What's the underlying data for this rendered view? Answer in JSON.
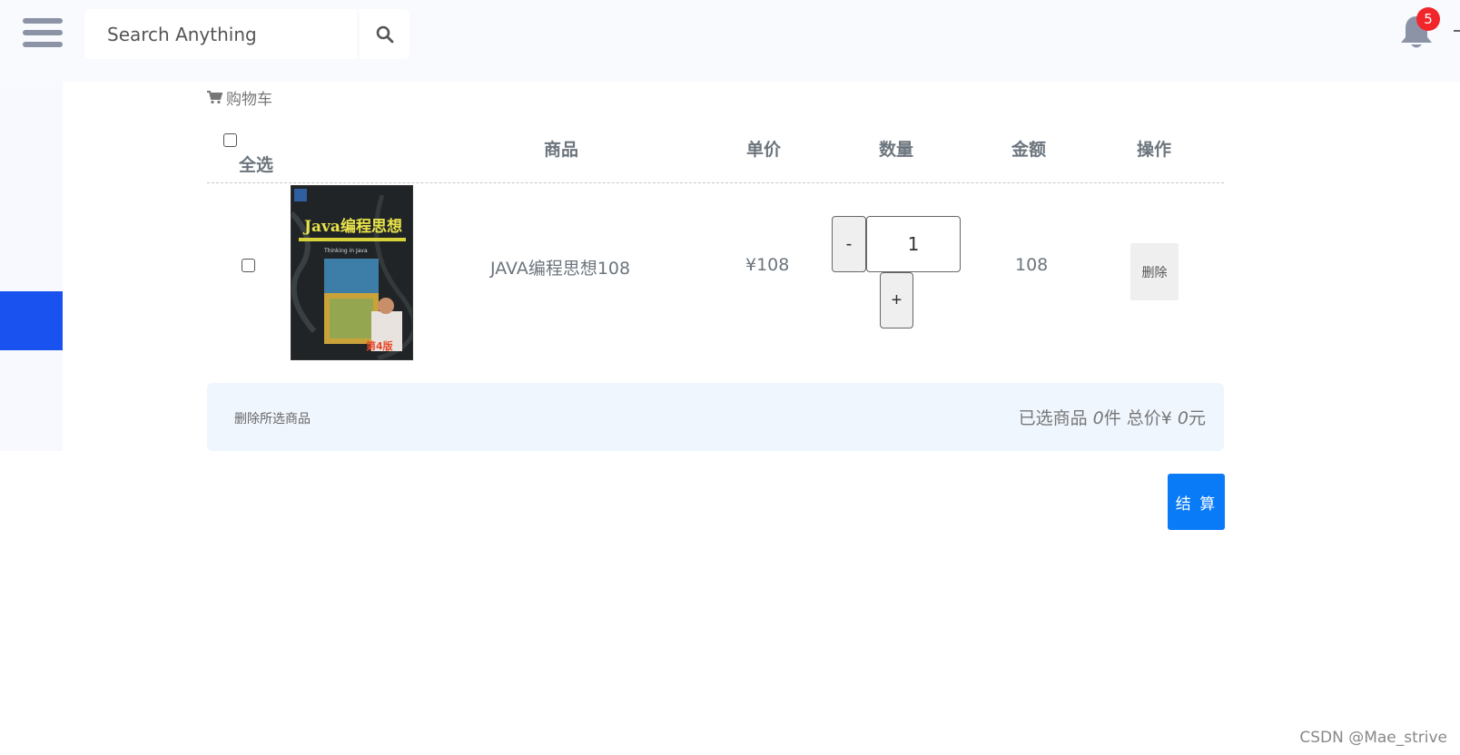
{
  "header": {
    "search_placeholder": "Search Anything",
    "notification_count": "5"
  },
  "breadcrumb": {
    "label": "购物车"
  },
  "table": {
    "headers": {
      "select_all": "全选",
      "product": "商品",
      "unit_price": "单价",
      "quantity": "数量",
      "amount": "金额",
      "action": "操作"
    },
    "rows": [
      {
        "book_cover_title": "Java编程思想",
        "book_cover_subtitle": "Thinking in Java",
        "book_cover_edition": "第4版",
        "product_name": "JAVA编程思想108",
        "unit_price": "¥108",
        "quantity": "1",
        "amount": "108",
        "delete_label": "删除",
        "minus_label": "-",
        "plus_label": "+"
      }
    ]
  },
  "summary": {
    "delete_selected": "删除所选商品",
    "selected_prefix": "已选商品 ",
    "selected_count": "0",
    "count_unit": "件 总价¥ ",
    "total": "0",
    "currency_unit": "元"
  },
  "checkout": {
    "label": "结 算"
  },
  "watermark": "CSDN @Mae_strive",
  "colors": {
    "accent": "#0a7bf7",
    "sidebar_active": "#1a52f0",
    "badge": "#f0262b",
    "summary_bg": "#f0f6fe"
  }
}
